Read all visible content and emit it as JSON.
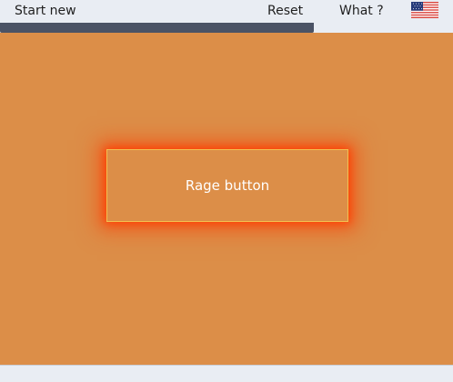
{
  "topbar": {
    "start_new_label": "Start new",
    "reset_label": "Reset",
    "what_label": "What ?",
    "language_icon": "us-flag-icon"
  },
  "progress": {
    "fraction": 0.693
  },
  "main": {
    "rage_button_label": "Rage button"
  },
  "colors": {
    "background": "#dc8e48",
    "topbar_background": "#e9edf3",
    "progress_fill": "#4b5365",
    "button_glow": "#ff3d00",
    "button_border": "#f2c051",
    "button_text": "#ffffff"
  }
}
